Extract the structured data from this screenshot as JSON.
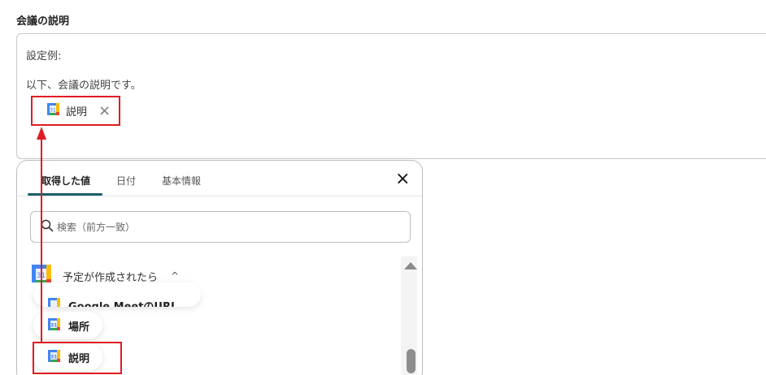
{
  "field": {
    "label": "会議の説明",
    "example_label": "設定例:",
    "text_before_chip": "以下、会議の説明です。",
    "chip": {
      "label": "説明",
      "remove_glyph": "×",
      "icon": "google-calendar-icon"
    }
  },
  "picker": {
    "tabs": [
      {
        "label": "取得した値",
        "active": true
      },
      {
        "label": "日付",
        "active": false
      },
      {
        "label": "基本情報",
        "active": false
      }
    ],
    "close_glyph": "×",
    "search": {
      "placeholder": "検索（前方一致）",
      "value": ""
    },
    "group": {
      "title": "予定が作成されたら",
      "expanded_glyph": "^",
      "icon": "google-calendar-icon"
    },
    "items": [
      {
        "label": "Google MeetのURL",
        "icon": "google-calendar-icon"
      },
      {
        "label": "場所",
        "icon": "google-calendar-icon"
      },
      {
        "label": "説明",
        "icon": "google-calendar-icon"
      }
    ]
  },
  "colors": {
    "highlight": "#e01b24",
    "tab_underline": "#1b5e6b",
    "calendar_blue": "#4285f4",
    "calendar_red": "#ea4335",
    "calendar_yellow": "#fbbc04",
    "calendar_green": "#34a853"
  }
}
